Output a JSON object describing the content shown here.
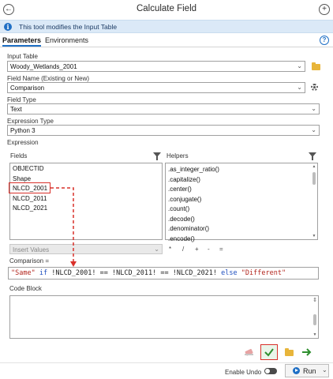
{
  "window": {
    "title": "Calculate Field",
    "back_label": "←",
    "add_label": "+"
  },
  "banner": {
    "text": "This tool modifies the Input Table",
    "info_glyph": "i"
  },
  "tabs": [
    {
      "label": "Parameters"
    },
    {
      "label": "Environments"
    }
  ],
  "help_glyph": "?",
  "input_table": {
    "label": "Input Table",
    "value": "Woody_Wetlands_2001"
  },
  "field_name": {
    "label": "Field Name (Existing or New)",
    "value": "Comparison"
  },
  "field_type": {
    "label": "Field Type",
    "value": "Text"
  },
  "expression_type": {
    "label": "Expression Type",
    "value": "Python 3"
  },
  "expression": {
    "label": "Expression",
    "fields_label": "Fields",
    "helpers_label": "Helpers",
    "fields": [
      "OBJECTID",
      "Shape",
      "NLCD_2001",
      "NLCD_2011",
      "NLCD_2021"
    ],
    "helpers": [
      ".as_integer_ratio()",
      ".capitalize()",
      ".center()",
      ".conjugate()",
      ".count()",
      ".decode()",
      ".denominator()",
      ".encode()"
    ],
    "insert_values_placeholder": "Insert Values",
    "operators": [
      "*",
      "/",
      "+",
      "-",
      "="
    ],
    "target_label": "Comparison =",
    "code": {
      "t1": "\"Same\"",
      "t2": "if",
      "t3": "!NLCD_2001! == !NLCD_2011! == !NLCD_2021!",
      "t4": "else",
      "t5": "\"Different\""
    }
  },
  "code_block": {
    "label": "Code Block"
  },
  "footer": {
    "enable_undo_label": "Enable Undo",
    "run_label": "Run"
  },
  "colors": {
    "accent": "#1f6fc5",
    "highlight": "#d9302a",
    "banner_bg": "#dbe9f7",
    "check_green": "#2f8f2f"
  }
}
